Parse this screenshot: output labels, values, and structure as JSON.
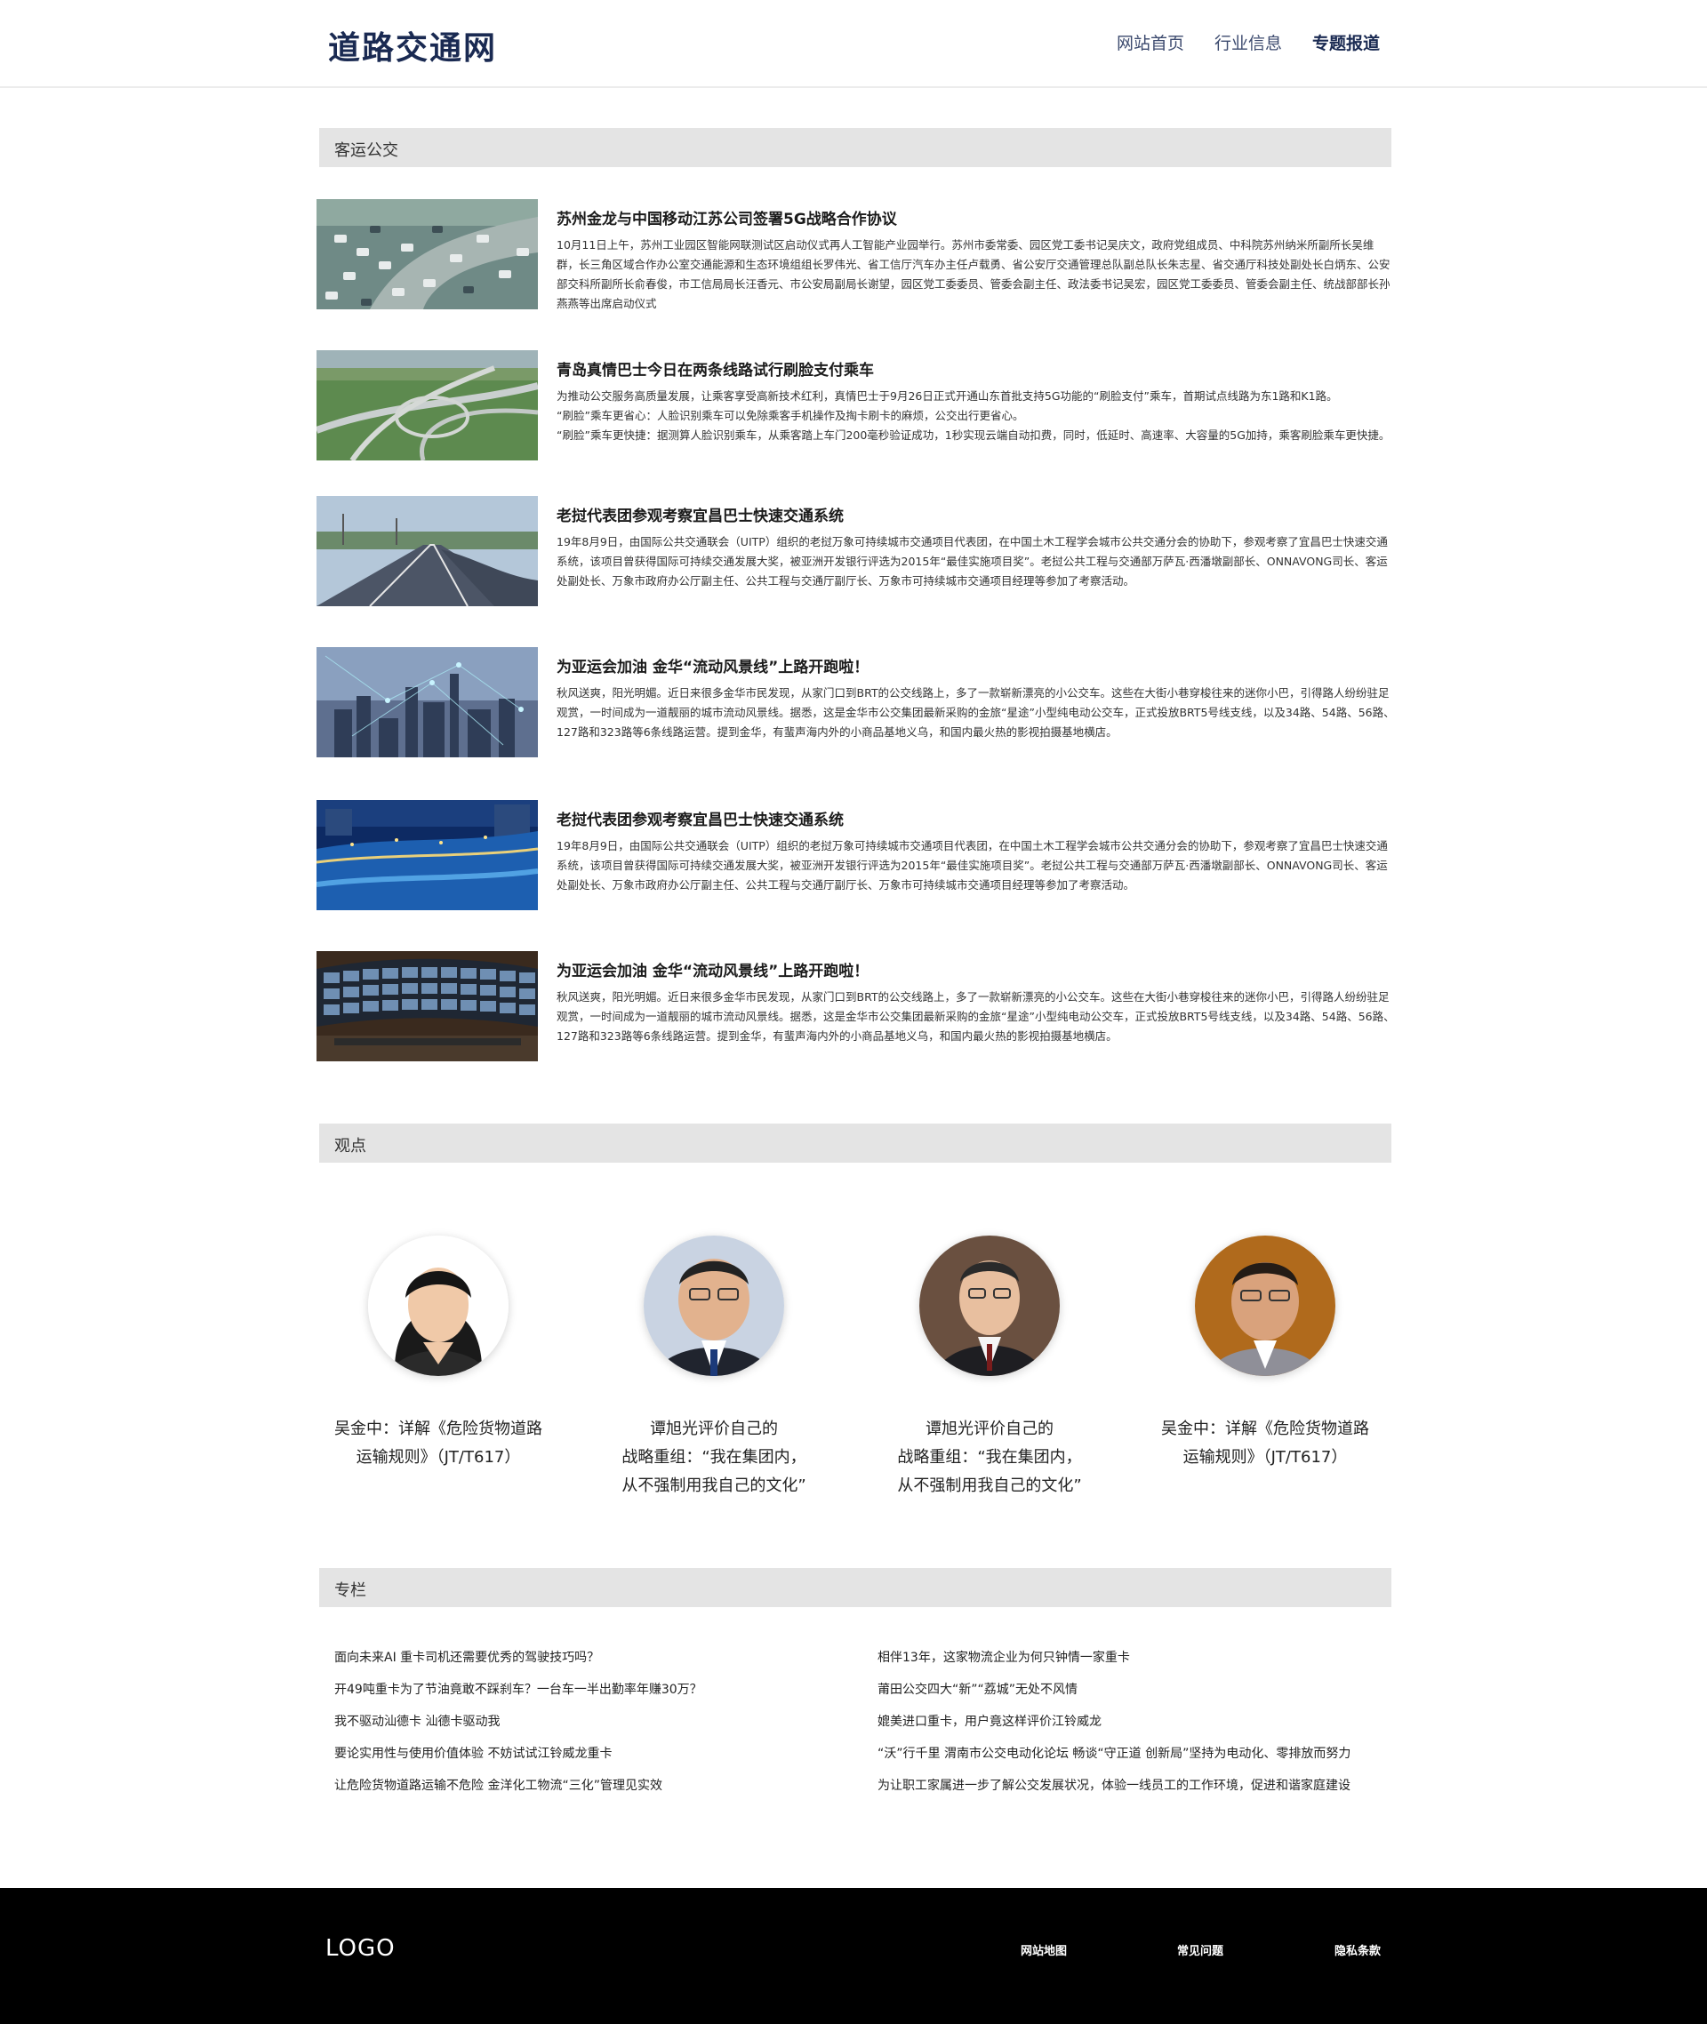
{
  "header": {
    "site_title": "道路交通网",
    "nav": [
      {
        "label": "网站首页"
      },
      {
        "label": "行业信息"
      },
      {
        "label": "专题报道"
      }
    ]
  },
  "sections": {
    "bus": "客运公交",
    "opinion": "观点",
    "column": "专栏"
  },
  "news": [
    {
      "title": "苏州金龙与中国移动江苏公司签署5G战略合作协议",
      "desc": [
        "10月11日上午，苏州工业园区智能网联测试区启动仪式再人工智能产业园举行。苏州市委常委、园区党工委书记吴庆文，政府党组成员、中科院苏州纳米所副所长吴维群，长三角区域合作办公室交通能源和生态环境组组长罗伟光、省工信厅汽车办主任卢载勇、省公安厅交通管理总队副总队长朱志星、省交通厅科技处副处长白炳东、公安部交科所副所长俞春俊，市工信局局长汪香元、市公安局副局长谢望，园区党工委委员、管委会副主任、政法委书记吴宏，园区党工委委员、管委会副主任、统战部部长孙燕燕等出席启动仪式"
      ]
    },
    {
      "title": "青岛真情巴士今日在两条线路试行刷脸支付乘车",
      "desc": [
        "为推动公交服务高质量发展，让乘客享受高新技术红利，真情巴士于9月26日正式开通山东首批支持5G功能的“刷脸支付”乘车，首期试点线路为东1路和K1路。",
        "“刷脸”乘车更省心：人脸识别乘车可以免除乘客手机操作及掏卡刷卡的麻烦，公交出行更省心。",
        "“刷脸”乘车更快捷：据测算人脸识别乘车，从乘客踏上车门200毫秒验证成功，1秒实现云端自动扣费，同时，低延时、高速率、大容量的5G加持，乘客刷脸乘车更快捷。"
      ]
    },
    {
      "title": "老挝代表团参观考察宜昌巴士快速交通系统",
      "desc": [
        "19年8月9日，由国际公共交通联会（UITP）组织的老挝万象可持续城市交通项目代表团，在中国土木工程学会城市公共交通分会的协助下，参观考察了宜昌巴士快速交通系统，该项目曾获得国际可持续交通发展大奖，被亚洲开发银行评选为2015年“最佳实施项目奖”。老挝公共工程与交通部万萨瓦·西潘墩副部长、ONNAVONG司长、客运处副处长、万象市政府办公厅副主任、公共工程与交通厅副厅长、万象市可持续城市交通项目经理等参加了考察活动。"
      ]
    },
    {
      "title": "为亚运会加油 金华“流动风景线”上路开跑啦！",
      "desc": [
        "秋风送爽，阳光明媚。近日来很多金华市民发现，从家门口到BRT的公交线路上，多了一款崭新漂亮的小公交车。这些在大街小巷穿梭往来的迷你小巴，引得路人纷纷驻足观赏，一时间成为一道靓丽的城市流动风景线。据悉，这是金华市公交集团最新采购的金旅“星途”小型纯电动公交车，正式投放BRT5号线支线，以及34路、54路、56路、127路和323路等6条线路运营。提到金华，有蜚声海内外的小商品基地义乌，和国内最火热的影视拍摄基地横店。"
      ]
    },
    {
      "title": "老挝代表团参观考察宜昌巴士快速交通系统",
      "desc": [
        "19年8月9日，由国际公共交通联会（UITP）组织的老挝万象可持续城市交通项目代表团，在中国土木工程学会城市公共交通分会的协助下，参观考察了宜昌巴士快速交通系统，该项目曾获得国际可持续交通发展大奖，被亚洲开发银行评选为2015年“最佳实施项目奖”。老挝公共工程与交通部万萨瓦·西潘墩副部长、ONNAVONG司长、客运处副处长、万象市政府办公厅副主任、公共工程与交通厅副厅长、万象市可持续城市交通项目经理等参加了考察活动。"
      ]
    },
    {
      "title": "为亚运会加油 金华“流动风景线”上路开跑啦！",
      "desc": [
        "秋风送爽，阳光明媚。近日来很多金华市民发现，从家门口到BRT的公交线路上，多了一款崭新漂亮的小公交车。这些在大街小巷穿梭往来的迷你小巴，引得路人纷纷驻足观赏，一时间成为一道靓丽的城市流动风景线。据悉，这是金华市公交集团最新采购的金旅“星途”小型纯电动公交车，正式投放BRT5号线支线，以及34路、54路、56路、127路和323路等6条线路运营。提到金华，有蜚声海内外的小商品基地义乌，和国内最火热的影视拍摄基地横店。"
      ]
    }
  ],
  "opinions": [
    {
      "lines": [
        "吴金中：详解《危险货物道路",
        "运输规则》（JT/T617）"
      ]
    },
    {
      "lines": [
        "谭旭光评价自己的",
        "战略重组：“我在集团内，",
        "从不强制用我自己的文化”"
      ]
    },
    {
      "lines": [
        "谭旭光评价自己的",
        "战略重组：“我在集团内，",
        "从不强制用我自己的文化”"
      ]
    },
    {
      "lines": [
        "吴金中：详解《危险货物道路",
        "运输规则》（JT/T617）"
      ]
    }
  ],
  "columns": {
    "left": [
      "面向未来AI 重卡司机还需要优秀的驾驶技巧吗？",
      "开49吨重卡为了节油竟敢不踩刹车？一台车一半出勤率年赚30万？",
      "我不驱动汕德卡 汕德卡驱动我",
      "要论实用性与使用价值体验 不妨试试江铃威龙重卡",
      "让危险货物道路运输不危险 金洋化工物流“三化”管理见实效"
    ],
    "right": [
      "相伴13年，这家物流企业为何只钟情一家重卡",
      "莆田公交四大“新”“荔城”无处不风情",
      "媲美进口重卡，用户竟这样评价江铃威龙",
      "“沃”行千里 渭南市公交电动化论坛 畅谈“守正道 创新局”坚持为电动化、零排放而努力",
      "为让职工家属进一步了解公交发展状况，体验一线员工的工作环境，促进和谐家庭建设"
    ]
  },
  "footer": {
    "logo": "LOGO",
    "links": [
      {
        "label": "网站地图"
      },
      {
        "label": "常见问题"
      },
      {
        "label": "隐私条款"
      }
    ]
  }
}
